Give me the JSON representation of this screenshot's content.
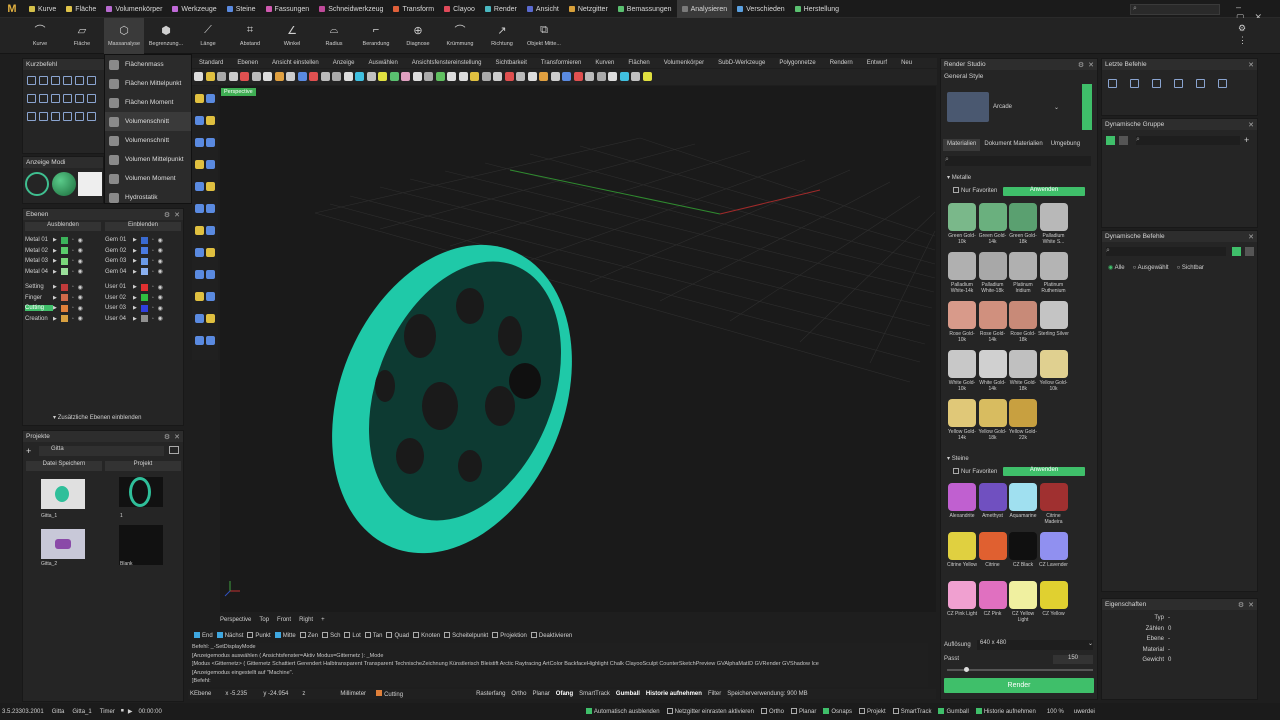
{
  "app": {
    "logo": "M"
  },
  "menu": {
    "tabs": [
      {
        "label": "Kurve",
        "color": "#d4c04a"
      },
      {
        "label": "Fläche",
        "color": "#e0c44a"
      },
      {
        "label": "Volumenkörper",
        "color": "#b86ad0"
      },
      {
        "label": "Werkzeuge",
        "color": "#c06ad8"
      },
      {
        "label": "Steine",
        "color": "#5a8ae0"
      },
      {
        "label": "Fassungen",
        "color": "#d05ab0"
      },
      {
        "label": "Schneidwerkzeug",
        "color": "#c04a9a"
      },
      {
        "label": "Transform",
        "color": "#e0603a"
      },
      {
        "label": "Clayoo",
        "color": "#e04a5a"
      },
      {
        "label": "Render",
        "color": "#4ab8c0"
      },
      {
        "label": "Ansicht",
        "color": "#5a6ad0"
      },
      {
        "label": "Netzgitter",
        "color": "#d8a03a"
      },
      {
        "label": "Bemassungen",
        "color": "#5ac070"
      },
      {
        "label": "Analysieren",
        "color": "#7a7a7a"
      },
      {
        "label": "Verschieden",
        "color": "#5aa0e0"
      },
      {
        "label": "Herstellung",
        "color": "#5ac070"
      }
    ],
    "active": "Analysieren"
  },
  "ribbon": {
    "buttons": [
      {
        "label": "Kurve",
        "icon": "curve-icon"
      },
      {
        "label": "Fläche",
        "icon": "surface-icon"
      },
      {
        "label": "Massanalyse",
        "icon": "mass-icon"
      },
      {
        "label": "Begrenzung...",
        "icon": "bounding-icon"
      },
      {
        "label": "Länge",
        "icon": "length-icon"
      },
      {
        "label": "Abstand",
        "icon": "distance-icon"
      },
      {
        "label": "Winkel",
        "icon": "angle-icon"
      },
      {
        "label": "Radius",
        "icon": "radius-icon"
      },
      {
        "label": "Berandung",
        "icon": "edge-icon"
      },
      {
        "label": "Diagnose",
        "icon": "diagnose-icon"
      },
      {
        "label": "Krümmung",
        "icon": "curvature-icon"
      },
      {
        "label": "Richtung",
        "icon": "direction-icon"
      },
      {
        "label": "Objekt Mitte...",
        "icon": "object-center-icon"
      }
    ]
  },
  "dropdown": {
    "items": [
      "Flächenmass",
      "Flächen Mittelpunkt",
      "Flächen Moment",
      "Volumenschnitt",
      "Volumenschnitt",
      "Volumen Mittelpunkt",
      "Volumen Moment",
      "Hydrostatik"
    ]
  },
  "kurzbefehl": {
    "title": "Kurzbefehl"
  },
  "anzeige": {
    "title": "Anzeige Modi"
  },
  "ebenen": {
    "title": "Ebenen",
    "hide": "Ausblenden",
    "show": "Einblenden",
    "more": "Zusätzliche Ebenen einblenden",
    "left": [
      {
        "name": "Metal 01",
        "color": "#3bb35a"
      },
      {
        "name": "Metal 02",
        "color": "#5acb6a"
      },
      {
        "name": "Metal 03",
        "color": "#7ad87a"
      },
      {
        "name": "Metal 04",
        "color": "#9ae09a"
      },
      {
        "name": "Setting",
        "color": "#c03a3a"
      },
      {
        "name": "Finger",
        "color": "#d06a4a"
      },
      {
        "name": "Cutting",
        "color": "#e0803a"
      },
      {
        "name": "Creation",
        "color": "#d8a040"
      }
    ],
    "right": [
      {
        "name": "Gem 01",
        "color": "#3a6ad0"
      },
      {
        "name": "Gem 02",
        "color": "#4a7ae0"
      },
      {
        "name": "Gem 03",
        "color": "#6a9ae8"
      },
      {
        "name": "Gem 04",
        "color": "#8ab0f0"
      },
      {
        "name": "User 01",
        "color": "#e03030"
      },
      {
        "name": "User 02",
        "color": "#30c040"
      },
      {
        "name": "User 03",
        "color": "#3040e0"
      },
      {
        "name": "User 04",
        "color": "#909090"
      }
    ]
  },
  "projekte": {
    "title": "Projekte",
    "project": "Gitta",
    "save": "Datei Speichern",
    "projekt": "Projekt",
    "thumbs": [
      "Gitta_1",
      "1",
      "Gitta_2",
      "Blank"
    ]
  },
  "viewtabs": [
    "Standard",
    "Ebenen",
    "Ansicht einstellen",
    "Anzeige",
    "Auswählen",
    "Ansichtsfenstereinstellung",
    "Sichtbarkeit",
    "Transformieren",
    "Kurven",
    "Flächen",
    "Volumenkörper",
    "SubD-Werkzeuge",
    "Polygonnetze",
    "Rendern",
    "Entwurf",
    "Neu"
  ],
  "viewport": {
    "label": "Perspective"
  },
  "viewbottom": [
    "Perspective",
    "Top",
    "Front",
    "Right",
    "+"
  ],
  "snaps": [
    {
      "l": "End",
      "on": true
    },
    {
      "l": "Nächst",
      "on": true
    },
    {
      "l": "Punkt",
      "on": false
    },
    {
      "l": "Mitte",
      "on": true
    },
    {
      "l": "Zen",
      "on": false
    },
    {
      "l": "Sch",
      "on": false
    },
    {
      "l": "Lot",
      "on": false
    },
    {
      "l": "Tan",
      "on": false
    },
    {
      "l": "Quad",
      "on": false
    },
    {
      "l": "Knoten",
      "on": false
    },
    {
      "l": "Scheitelpunkt",
      "on": false
    },
    {
      "l": "Projektion",
      "on": false
    },
    {
      "l": "Deaktivieren",
      "on": false
    }
  ],
  "cmd": {
    "lines": [
      "Befehl: _-SetDisplayMode",
      "[Anzeigemodus auswählen ( Ansichtsfenster=Aktiv Modus=Gitternetz ): _Mode",
      "]Modus <Gitternetz> ( Gitternetz Schattiert Gerendert Halbtransparent Transparent TechnischeZeichnung Künstlerisch Bleistift Arctic Raytracing ArtColor BackfaceHighlight Chalk ClayooSculpt CounterSketchPreview GVAlphaMatID GVRender GVShadow Ice",
      "[Anzeigemodus eingestellt auf \"Machine\".",
      "]Befehl:"
    ]
  },
  "coords": {
    "plane": "KEbene",
    "x": "x -5.235",
    "y": "y -24.954",
    "z": "z",
    "unit": "Millimeter",
    "layer": "Cutting",
    "items": [
      "Rasterfang",
      "Ortho",
      "Planar",
      "Ofang",
      "SmartTrack",
      "Gumball",
      "Historie aufnehmen",
      "Filter",
      "Speicherverwendung: 900 MB"
    ]
  },
  "status": {
    "version": "3.5.23303.2001",
    "file1": "Gitta",
    "file2": "Gitta_1",
    "timer": "Timer",
    "time": "00:00:00",
    "checks": [
      {
        "l": "Automatisch ausblenden",
        "on": true
      },
      {
        "l": "Netzgitter einrasten aktivieren",
        "on": false
      },
      {
        "l": "Ortho",
        "on": false
      },
      {
        "l": "Planar",
        "on": false
      },
      {
        "l": "Osnaps",
        "on": true
      },
      {
        "l": "Projekt",
        "on": false
      },
      {
        "l": "SmartTrack",
        "on": false
      },
      {
        "l": "Gumball",
        "on": true
      },
      {
        "l": "Historie aufnehmen",
        "on": true
      }
    ],
    "zoom": "100 %",
    "user": "uwerdei"
  },
  "render": {
    "title": "Render Studio",
    "style": "General Style",
    "preset": "Arcade",
    "tabs": [
      "Materialien",
      "Dokument Materialien",
      "Umgebung"
    ],
    "metals": "Metalle",
    "fav": "Nur Favoriten",
    "apply": "Anwenden",
    "stones": "Steine",
    "metalItems": [
      {
        "n": "Green Gold-10k",
        "c": "#7ab88a"
      },
      {
        "n": "Green Gold-14k",
        "c": "#6ab07e"
      },
      {
        "n": "Green Gold-18k",
        "c": "#5aa070"
      },
      {
        "n": "Palladium White S...",
        "c": "#b8b8b8"
      },
      {
        "n": "Palladium White-14k",
        "c": "#b0b0b0"
      },
      {
        "n": "Palladium White-18k",
        "c": "#a8a8a8"
      },
      {
        "n": "Platinum Iridium",
        "c": "#b0b0b0"
      },
      {
        "n": "Platinum Ruthenium",
        "c": "#b4b4b4"
      },
      {
        "n": "Rose Gold-10k",
        "c": "#d89a8a"
      },
      {
        "n": "Rose Gold-14k",
        "c": "#d0907e"
      },
      {
        "n": "Rose Gold-18k",
        "c": "#c88a78"
      },
      {
        "n": "Sterling Silver",
        "c": "#c4c4c4"
      },
      {
        "n": "White Gold-10k",
        "c": "#c8c8c8"
      },
      {
        "n": "White Gold-14k",
        "c": "#d0d0d0"
      },
      {
        "n": "White Gold-18k",
        "c": "#c0c0c0"
      },
      {
        "n": "Yellow Gold-10k",
        "c": "#e0d090"
      },
      {
        "n": "Yellow Gold-14k",
        "c": "#e0c878"
      },
      {
        "n": "Yellow Gold-18k",
        "c": "#d8bc60"
      },
      {
        "n": "Yellow Gold-22k",
        "c": "#c8a040"
      }
    ],
    "stoneItems": [
      {
        "n": "Alexandrite",
        "c": "#c060d0"
      },
      {
        "n": "Amethyst",
        "c": "#7050c0"
      },
      {
        "n": "Aquamarine",
        "c": "#a0e0f0"
      },
      {
        "n": "Citrine Madeira",
        "c": "#a03030"
      },
      {
        "n": "Citrine Yellow",
        "c": "#e0d040"
      },
      {
        "n": "Citrine",
        "c": "#e06030"
      },
      {
        "n": "CZ Black",
        "c": "#101010"
      },
      {
        "n": "CZ Lavender",
        "c": "#9090f0"
      },
      {
        "n": "CZ Pink Light",
        "c": "#f0a0d0"
      },
      {
        "n": "CZ Pink",
        "c": "#e070c0"
      },
      {
        "n": "CZ Yellow Light",
        "c": "#f0f0a0"
      },
      {
        "n": "CZ Yellow",
        "c": "#e0d030"
      }
    ],
    "resLabel": "Auflösung",
    "res": "640 x 480",
    "passLabel": "Passt",
    "pass": "150",
    "renderBtn": "Render"
  },
  "letzte": {
    "title": "Letzte Befehle"
  },
  "dyngroup": {
    "title": "Dynamische Gruppe"
  },
  "dynbefehl": {
    "title": "Dynamische Befehle",
    "opts": [
      "Alle",
      "Ausgewählt",
      "Sichtbar"
    ]
  },
  "props": {
    "title": "Eigenschaften",
    "rows": [
      {
        "k": "Typ",
        "v": "-"
      },
      {
        "k": "Zählen",
        "v": "0"
      },
      {
        "k": "Ebene",
        "v": "-"
      },
      {
        "k": "Material",
        "v": "-"
      },
      {
        "k": "Gewicht",
        "v": "0"
      }
    ]
  }
}
